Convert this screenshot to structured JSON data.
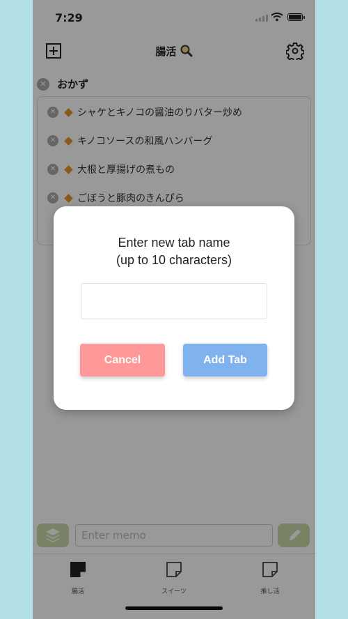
{
  "status_bar": {
    "time": "7:29"
  },
  "nav": {
    "title": "腸活"
  },
  "section": {
    "title": "おかず"
  },
  "items": [
    "シャケとキノコの醤油のりバター炒め",
    "キノコソースの和風ハンバーグ",
    "大根と厚揚げの煮もの",
    "ごぼうと豚肉のきんぴら"
  ],
  "memo": {
    "placeholder": "Enter memo"
  },
  "tabs": [
    {
      "label": "腸活"
    },
    {
      "label": "スイーツ"
    },
    {
      "label": "推し活"
    }
  ],
  "modal": {
    "title_line1": "Enter new tab name",
    "title_line2": "(up to 10 characters)",
    "input_value": "",
    "cancel_label": "Cancel",
    "add_label": "Add Tab"
  },
  "colors": {
    "cancel": "#ff9999",
    "add": "#7fb2ef",
    "accent_green": "#c8d9a8",
    "diamond": "#e8962c",
    "frame": "#b3dfe6"
  }
}
